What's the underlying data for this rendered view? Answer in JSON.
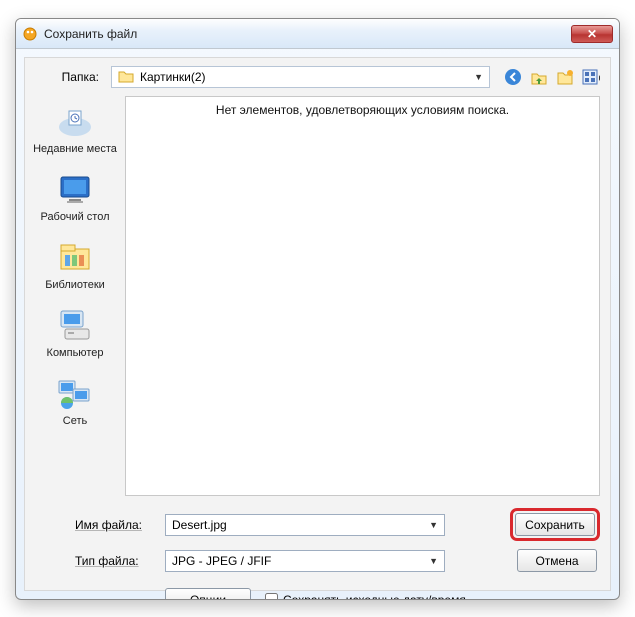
{
  "window": {
    "title": "Сохранить файл"
  },
  "folder": {
    "label": "Папка:",
    "current": "Картинки(2)"
  },
  "nav": {
    "back": "back-icon",
    "up": "up-icon",
    "newfolder": "new-folder-icon",
    "views": "views-icon"
  },
  "places": [
    {
      "label": "Недавние места",
      "icon": "recent"
    },
    {
      "label": "Рабочий стол",
      "icon": "desktop"
    },
    {
      "label": "Библиотеки",
      "icon": "libraries"
    },
    {
      "label": "Компьютер",
      "icon": "computer"
    },
    {
      "label": "Сеть",
      "icon": "network"
    }
  ],
  "filelist": {
    "empty_message": "Нет элементов, удовлетворяющих условиям поиска."
  },
  "filename": {
    "label": "Имя файла:",
    "value": "Desert.jpg"
  },
  "filetype": {
    "label": "Тип файла:",
    "value": "JPG - JPEG / JFIF"
  },
  "buttons": {
    "save": "Сохранить",
    "cancel": "Отмена",
    "options": "Опции"
  },
  "checkbox": {
    "preserve_date": "Сохранять исходные дату/время",
    "checked": false
  }
}
